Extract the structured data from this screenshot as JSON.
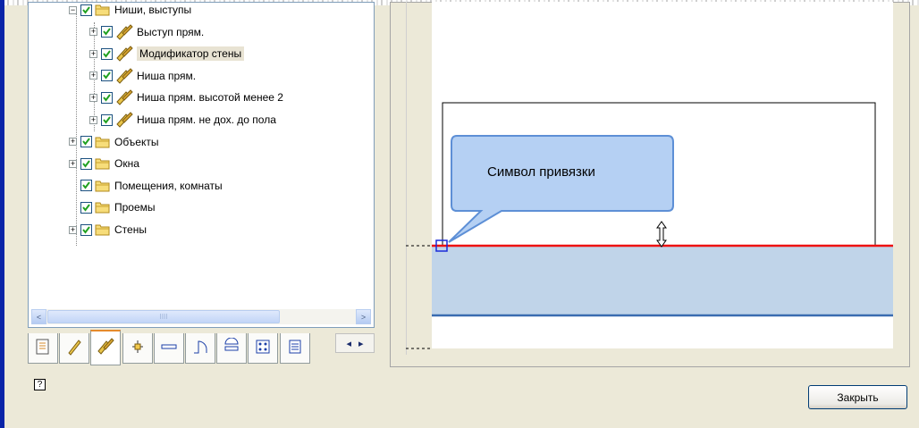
{
  "tree": {
    "items": [
      {
        "label": "Ниши, выступы",
        "icon": "folder-icon",
        "expander": "minus",
        "checked": true
      },
      {
        "label": "Выступ прям.",
        "icon": "wall-modifier-icon",
        "expander": "plus",
        "checked": true
      },
      {
        "label": "Модификатор стены",
        "icon": "wall-modifier-icon",
        "expander": "plus",
        "checked": true
      },
      {
        "label": "Ниша прям.",
        "icon": "wall-modifier-icon",
        "expander": "plus",
        "checked": true
      },
      {
        "label": "Ниша прям. высотой менее 2",
        "icon": "wall-modifier-icon",
        "expander": "plus",
        "checked": true
      },
      {
        "label": "Ниша прям. не дох. до пола",
        "icon": "wall-modifier-icon",
        "expander": "plus",
        "checked": true
      },
      {
        "label": "Объекты",
        "icon": "folder-icon",
        "expander": "plus",
        "checked": true
      },
      {
        "label": "Окна",
        "icon": "folder-icon",
        "expander": "plus",
        "checked": true
      },
      {
        "label": "Помещения, комнаты",
        "icon": "folder-icon",
        "expander": "none",
        "checked": true
      },
      {
        "label": "Проемы",
        "icon": "folder-icon",
        "expander": "none",
        "checked": true
      },
      {
        "label": "Стены",
        "icon": "folder-icon",
        "expander": "plus",
        "checked": true
      }
    ],
    "selected_label": "Модификатор стены"
  },
  "scrollbar": {
    "left_arrow": "<",
    "right_arrow": ">",
    "thumb_grip": "IIII"
  },
  "tabs": [
    {
      "icon": "document-properties-icon"
    },
    {
      "icon": "wall-icon"
    },
    {
      "icon": "wall-modifier-icon",
      "active": true
    },
    {
      "icon": "column-icon"
    },
    {
      "icon": "beam-icon"
    },
    {
      "icon": "door-icon"
    },
    {
      "icon": "window-icon"
    },
    {
      "icon": "grid-icon"
    },
    {
      "icon": "list-icon"
    }
  ],
  "tab_scroll": {
    "left": "◂",
    "right": "▸"
  },
  "preview": {
    "callout_text": "Символ привязки",
    "colors": {
      "wall_fill": "#c0d4e9",
      "wall_top_line": "#ee1111",
      "wall_bottom_line": "#3a6cb0",
      "anchor_square": "#1a2bd9",
      "callout_fill": "#b5d0f3",
      "callout_border": "#5d8fd6"
    }
  },
  "buttons": {
    "close_label": "Закрыть"
  },
  "help_icon": {
    "label": "?"
  }
}
